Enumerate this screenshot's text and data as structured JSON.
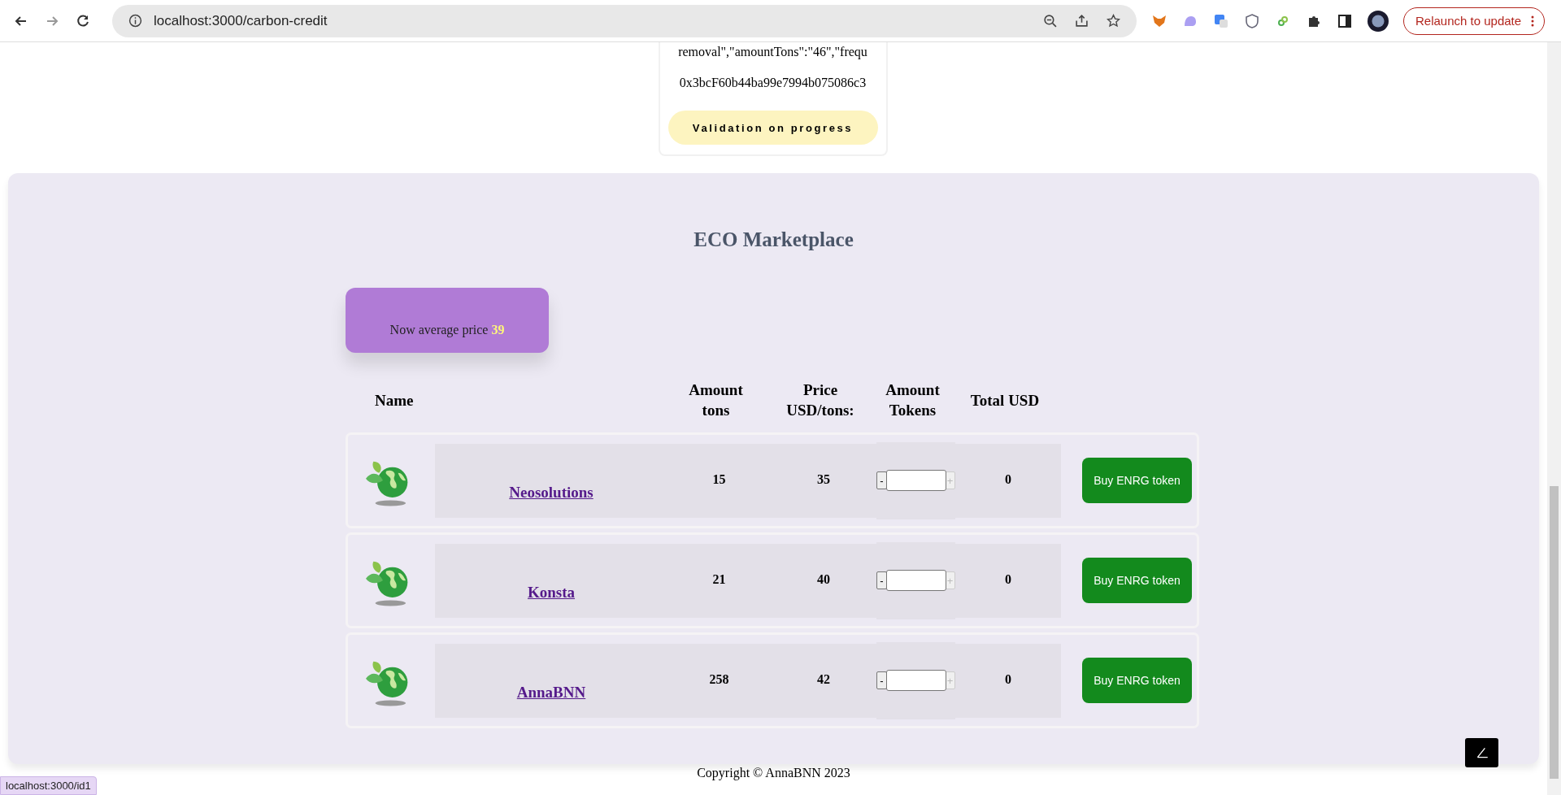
{
  "browser": {
    "url": "localhost:3000/carbon-credit",
    "relaunch": "Relaunch to update"
  },
  "request_card": {
    "lines": [
      "removal\",\"amountTons\":\"46\",\"frequ",
      "0x3bcF60b44ba99e7994b075086c3"
    ],
    "status": "Validation on progress"
  },
  "marketplace": {
    "title": "ECO Marketplace",
    "average_label": "Now average price",
    "average_value": "39",
    "columns": [
      "Name",
      "Amount tons",
      "Price USD/tons:",
      "Amount Tokens",
      "Total USD"
    ],
    "rows": [
      {
        "name": "Neosolutions",
        "amount_tons": "15",
        "price": "35",
        "decrement": "-",
        "increment": "+",
        "total": "0",
        "button": "Buy ENRG token"
      },
      {
        "name": "Konsta",
        "amount_tons": "21",
        "price": "40",
        "decrement": "-",
        "increment": "+",
        "total": "0",
        "button": "Buy ENRG token"
      },
      {
        "name": "AnnaBNN",
        "amount_tons": "258",
        "price": "42",
        "decrement": "-",
        "increment": "+",
        "total": "0",
        "button": "Buy ENRG token"
      }
    ]
  },
  "footer": "Copyright © AnnaBNN 2023",
  "status_url": "localhost:3000/id1"
}
